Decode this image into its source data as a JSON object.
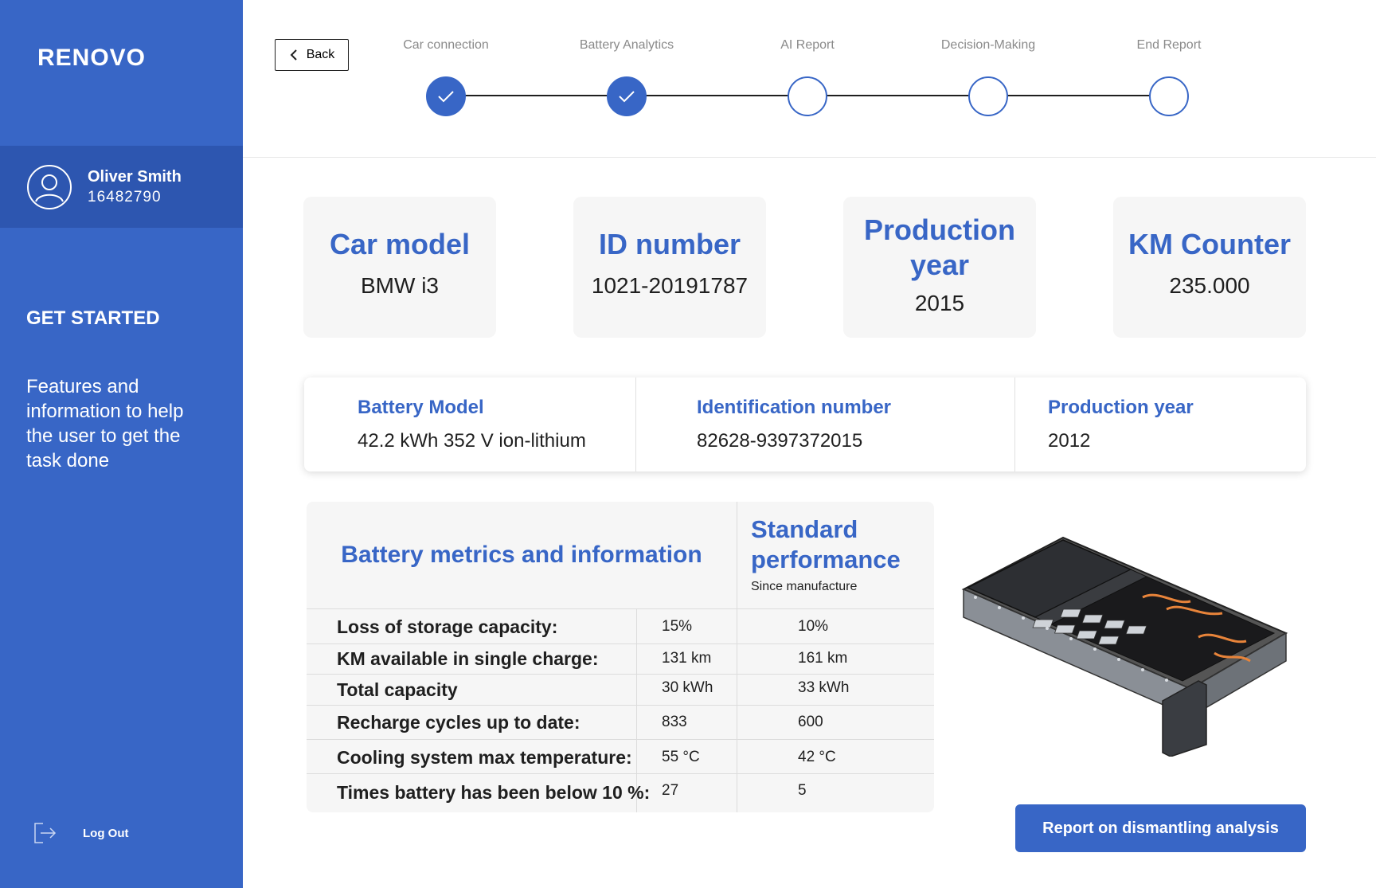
{
  "sidebar": {
    "logo": "RENOVO",
    "user": {
      "name": "Oliver Smith",
      "id": "16482790"
    },
    "get_started_title": "GET STARTED",
    "get_started_text": "Features and information to help the user to get the task done",
    "logout_label": "Log Out"
  },
  "header": {
    "back_label": "Back",
    "steps": [
      {
        "label": "Car connection",
        "status": "done"
      },
      {
        "label": "Battery Analytics",
        "status": "done"
      },
      {
        "label": "AI Report",
        "status": "pending"
      },
      {
        "label": "Decision-Making",
        "status": "pending"
      },
      {
        "label": "End Report",
        "status": "pending"
      }
    ]
  },
  "car_cards": [
    {
      "title": "Car model",
      "value": "BMW i3"
    },
    {
      "title": "ID number",
      "value": "1021-20191787"
    },
    {
      "title": "Production year",
      "value": "2015"
    },
    {
      "title": "KM Counter",
      "value": "235.000"
    }
  ],
  "battery_info": [
    {
      "label": "Battery Model",
      "value": "42.2 kWh 352 V ion-lithium"
    },
    {
      "label": "Identification number",
      "value": "82628-9397372015"
    },
    {
      "label": "Production year",
      "value": "2012"
    }
  ],
  "metrics": {
    "title": "Battery metrics and information",
    "standard_title": "Standard performance",
    "standard_subtitle": "Since manufacture",
    "rows": [
      {
        "label": "Loss of storage capacity:",
        "current": "15%",
        "standard": "10%"
      },
      {
        "label": "KM available in single charge:",
        "current": "131  km",
        "standard": "161  km"
      },
      {
        "label": "Total capacity",
        "current": "30 kWh",
        "standard": "33 kWh"
      },
      {
        "label": "Recharge cycles up to date:",
        "current": "833",
        "standard": "600"
      },
      {
        "label": "Cooling system max temperature:",
        "current": "55 °C",
        "standard": "42 °C"
      },
      {
        "label": "Times battery has been below 10 %:",
        "current": "27",
        "standard": "5"
      }
    ]
  },
  "report_button_label": "Report on dismantling analysis",
  "colors": {
    "primary": "#3866c6",
    "sidebar_dark": "#2d56b0",
    "card_bg": "#f6f6f6"
  },
  "icons": [
    "user-avatar-icon",
    "logout-icon",
    "chevron-left-icon",
    "check-icon",
    "battery-pack-image"
  ]
}
